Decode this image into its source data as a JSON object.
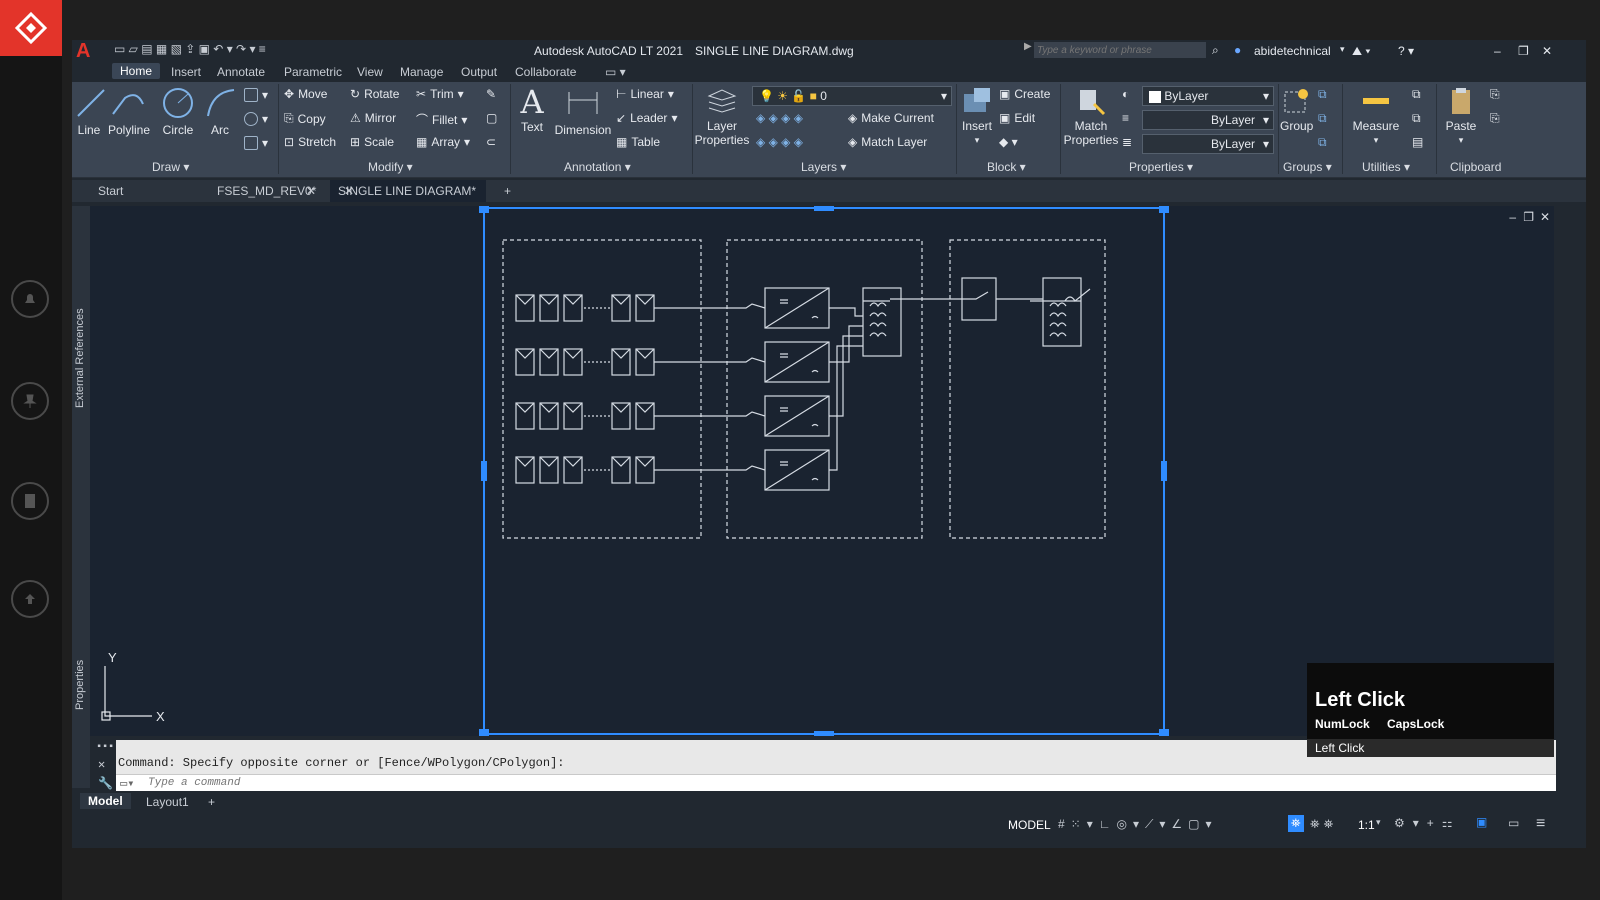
{
  "app": {
    "title": "Autodesk AutoCAD LT 2021",
    "file": "SINGLE LINE DIAGRAM.dwg",
    "search_placeholder": "Type a keyword or phrase",
    "user": "abidetechnical"
  },
  "ribbon_tabs": [
    "Home",
    "Insert",
    "Annotate",
    "Parametric",
    "View",
    "Manage",
    "Output",
    "Collaborate"
  ],
  "ribbon": {
    "draw": {
      "title": "Draw",
      "line": "Line",
      "polyline": "Polyline",
      "circle": "Circle",
      "arc": "Arc"
    },
    "modify": {
      "title": "Modify",
      "move": "Move",
      "rotate": "Rotate",
      "trim": "Trim",
      "copy": "Copy",
      "mirror": "Mirror",
      "fillet": "Fillet",
      "stretch": "Stretch",
      "scale": "Scale",
      "array": "Array"
    },
    "annotation": {
      "title": "Annotation",
      "text": "Text",
      "dimension": "Dimension",
      "linear": "Linear",
      "leader": "Leader",
      "table": "Table"
    },
    "layers": {
      "title": "Layers",
      "layer_properties": "Layer Properties",
      "current_layer": "0",
      "make_current": "Make Current",
      "match_layer": "Match Layer"
    },
    "block": {
      "title": "Block",
      "insert": "Insert",
      "create": "Create",
      "edit": "Edit"
    },
    "properties": {
      "title": "Properties",
      "match_properties": "Match Properties",
      "color": "ByLayer",
      "linetype": "ByLayer",
      "lineweight": "ByLayer"
    },
    "groups": {
      "title": "Groups",
      "group": "Group"
    },
    "utilities": {
      "title": "Utilities",
      "measure": "Measure"
    },
    "clipboard": {
      "title": "Clipboard",
      "paste": "Paste"
    }
  },
  "doc_tabs": [
    "Start",
    "FSES_MD_REV0*",
    "SINGLE LINE DIAGRAM*"
  ],
  "palettes": {
    "external_references": "External References",
    "properties": "Properties"
  },
  "ucs": {
    "x": "X",
    "y": "Y"
  },
  "command": {
    "history": "Command: Specify opposite corner or [Fence/WPolygon/CPolygon]:",
    "placeholder": "Type a command"
  },
  "layout_tabs": [
    "Model",
    "Layout1"
  ],
  "status": {
    "model": "MODEL",
    "scale": "1:1"
  },
  "overlay": {
    "title": "Left Click",
    "numlock": "NumLock",
    "capslock": "CapsLock",
    "sub": "Left Click"
  },
  "colors": {
    "accent": "#e3342a",
    "selection": "#2f8cff",
    "canvas": "#1a2330",
    "ribbon": "#3b4553"
  }
}
